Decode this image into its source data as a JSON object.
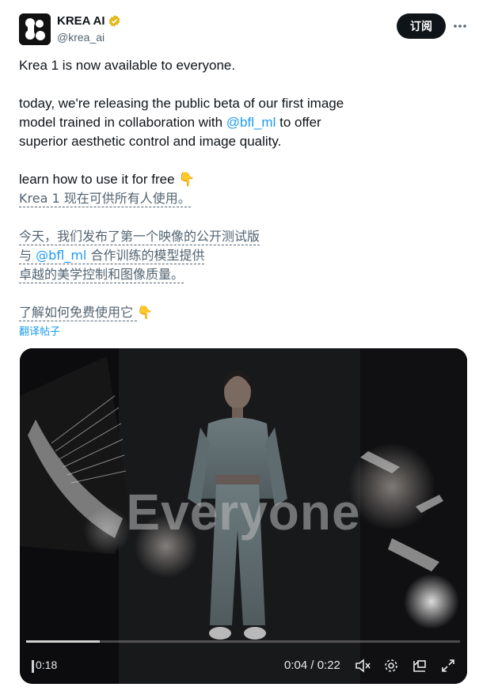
{
  "account": {
    "name": "KREA AI",
    "handle": "@krea_ai",
    "verified_color": "#e2b719"
  },
  "header": {
    "subscribe_label": "订阅",
    "more_icon": "more-horizontal-icon"
  },
  "post": {
    "line1": "Krea 1 is now available to everyone.",
    "line2": "today, we're releasing the public beta of our first image",
    "line3_pre": "model trained in collaboration with ",
    "line3_mention": "@bfl_ml",
    "line3_post": " to offer",
    "line4": "superior aesthetic control and image quality.",
    "line5": "learn how to use it for free ",
    "line5_emoji": "👇"
  },
  "translation": {
    "zh1": "Krea 1 现在可供所有人使用。",
    "zh2": "今天，我们发布了第一个映像的公开测试版",
    "zh3_pre": "与 ",
    "zh3_mention": "@bfl_ml",
    "zh3_post": " 合作训练的模型提供",
    "zh4": "卓越的美学控制和图像质量。",
    "zh5": "了解如何免费使用它 ",
    "zh5_emoji": "👇",
    "translate_link": "翻译帖子"
  },
  "media": {
    "overlay_text": "Everyone",
    "current_time_left": "0:18",
    "time_display": "0:04 / 0:22",
    "progress_fraction": 0.17,
    "controls": [
      "mute-icon",
      "settings-gear-icon",
      "pip-icon",
      "fullscreen-icon"
    ]
  },
  "colors": {
    "link": "#1d9bf0",
    "text": "#0f1419",
    "secondary": "#536471"
  }
}
